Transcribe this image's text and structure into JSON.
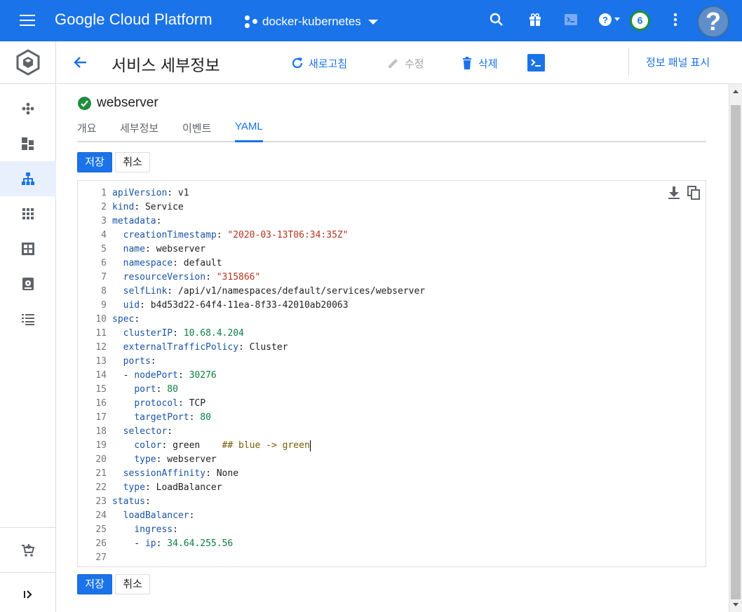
{
  "topbar": {
    "brand": "Google Cloud Platform",
    "project": "docker-kubernetes",
    "notification_count": "6",
    "help_avatar": "?",
    "icons": [
      "menu-icon",
      "project-dots-icon",
      "search-icon",
      "gift-icon",
      "cloud-shell-icon",
      "help-icon",
      "more-vert-icon"
    ]
  },
  "header": {
    "title": "서비스 세부정보",
    "refresh": "새로고침",
    "edit": "수정",
    "delete": "삭제",
    "info_panel": "정보 패널 표시"
  },
  "service": {
    "name": "webserver",
    "status": "ok"
  },
  "tabs": [
    {
      "label": "개요",
      "active": false
    },
    {
      "label": "세부정보",
      "active": false
    },
    {
      "label": "이벤트",
      "active": false
    },
    {
      "label": "YAML",
      "active": true
    }
  ],
  "buttons": {
    "save": "저장",
    "cancel": "취소"
  },
  "yaml_lines": [
    {
      "n": "1",
      "text": "apiVersion: v1"
    },
    {
      "n": "2",
      "text": "kind: Service"
    },
    {
      "n": "3",
      "text": "metadata:"
    },
    {
      "n": "4",
      "text": "  creationTimestamp: \"2020-03-13T06:34:35Z\""
    },
    {
      "n": "5",
      "text": "  name: webserver"
    },
    {
      "n": "6",
      "text": "  namespace: default"
    },
    {
      "n": "7",
      "text": "  resourceVersion: \"315866\""
    },
    {
      "n": "8",
      "text": "  selfLink: /api/v1/namespaces/default/services/webserver"
    },
    {
      "n": "9",
      "text": "  uid: b4d53d22-64f4-11ea-8f33-42010ab20063"
    },
    {
      "n": "10",
      "text": "spec:"
    },
    {
      "n": "11",
      "text": "  clusterIP: 10.68.4.204"
    },
    {
      "n": "12",
      "text": "  externalTrafficPolicy: Cluster"
    },
    {
      "n": "13",
      "text": "  ports:"
    },
    {
      "n": "14",
      "text": "  - nodePort: 30276"
    },
    {
      "n": "15",
      "text": "    port: 80"
    },
    {
      "n": "16",
      "text": "    protocol: TCP"
    },
    {
      "n": "17",
      "text": "    targetPort: 80"
    },
    {
      "n": "18",
      "text": "  selector:"
    },
    {
      "n": "19",
      "text": "    color: green    ## blue -> green"
    },
    {
      "n": "20",
      "text": "    type: webserver"
    },
    {
      "n": "21",
      "text": "  sessionAffinity: None"
    },
    {
      "n": "22",
      "text": "  type: LoadBalancer"
    },
    {
      "n": "23",
      "text": "status:"
    },
    {
      "n": "24",
      "text": "  loadBalancer:"
    },
    {
      "n": "25",
      "text": "    ingress:"
    },
    {
      "n": "26",
      "text": "    - ip: 34.64.255.56"
    },
    {
      "n": "27",
      "text": ""
    }
  ],
  "colors": {
    "brand_blue": "#1a73e8",
    "status_green": "#1e8e3e",
    "yaml_key": "#1a53a5",
    "yaml_string": "#b4341b",
    "yaml_number": "#0b8043",
    "yaml_comment": "#7a5a00"
  }
}
